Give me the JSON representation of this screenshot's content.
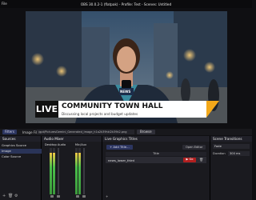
{
  "window": {
    "menu_label": "File",
    "title": "OBS 30.0.2-1 (flatpak) - Profile: Test - Scenes: Untitled"
  },
  "preview": {
    "lower_third": {
      "badge": "LIVE",
      "headline": "COMMUNITY TOWN HALL",
      "subheadline": "Discussing local projects and budget updates",
      "mic_flag": "NEWS",
      "colors": {
        "badge_bg": "#111111",
        "card_bg": "#ffffff",
        "accent": "#f3a81a"
      }
    }
  },
  "toolbar": {
    "filters_label": "Filters",
    "file_label": "Image File",
    "file_path": "/gpt/PicturesGemini_Generated_Image_h1a2k39hkl2k39k2.png",
    "browse_label": "Browse"
  },
  "sources": {
    "header": "Sources",
    "items": [
      {
        "label": "Graphics Source"
      },
      {
        "label": "Image"
      },
      {
        "label": "Color Source"
      }
    ]
  },
  "audio_mixer": {
    "header": "Audio Mixer",
    "channels": [
      {
        "label": "Desktop Audio",
        "level": 0.9
      },
      {
        "label": "Mic/Aux",
        "level": 0.9
      }
    ]
  },
  "live_graphics": {
    "header": "Live Graphics Titles",
    "add_label": "+ Add Title...",
    "edit_label": "Open Editor",
    "column_title": "Title",
    "rows": [
      {
        "name": "news_lower_third",
        "go_label": "▶ Go"
      }
    ]
  },
  "scene_transitions": {
    "header": "Scene Transitions",
    "transition": "Fade",
    "duration_label": "Duration",
    "duration_value": "300 ms"
  }
}
